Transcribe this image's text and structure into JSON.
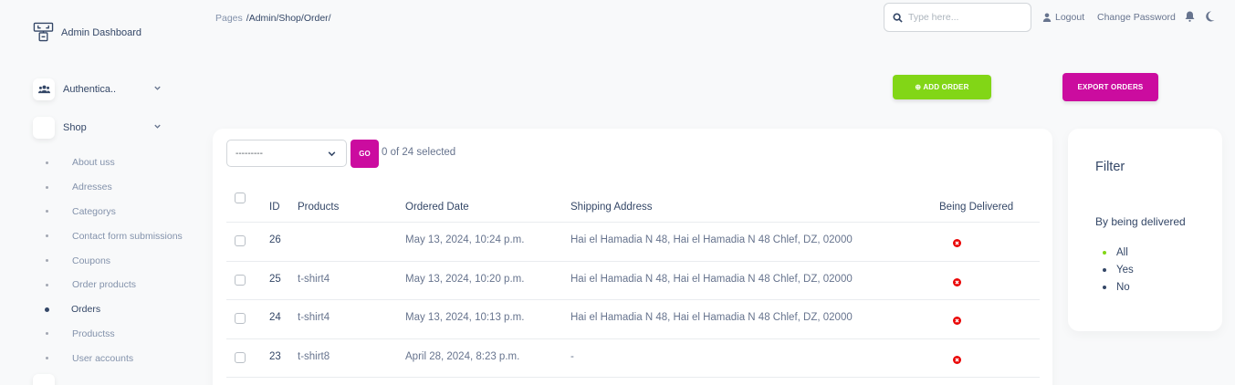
{
  "brand": {
    "name": "Admin Dashboard"
  },
  "sidebar": {
    "groups": [
      {
        "label": "Authentica..",
        "icon": "users-icon"
      },
      {
        "label": "Shop",
        "icon": "shop-icon"
      }
    ],
    "items": [
      {
        "label": "About uss"
      },
      {
        "label": "Adresses"
      },
      {
        "label": "Categorys"
      },
      {
        "label": "Contact form submissions"
      },
      {
        "label": "Coupons"
      },
      {
        "label": "Order products"
      },
      {
        "label": "Orders",
        "active": true
      },
      {
        "label": "Productss"
      },
      {
        "label": "User accounts"
      }
    ]
  },
  "header": {
    "breadcrumb_root": "Pages",
    "breadcrumb_path": "/Admin/Shop/Order/",
    "search_placeholder": "Type here...",
    "logout_label": "Logout",
    "change_password_label": "Change Password"
  },
  "actions": {
    "add_label": "ADD ORDER",
    "export_label": "EXPORT ORDERS"
  },
  "bulk": {
    "select_value": "---------",
    "go_label": "GO",
    "selected_text": "0 of 24 selected"
  },
  "table": {
    "columns": [
      "ID",
      "Products",
      "Ordered Date",
      "Shipping Address",
      "Being Delivered"
    ],
    "rows": [
      {
        "id": "26",
        "products": "",
        "date": "May 13, 2024, 10:24 p.m.",
        "address": "Hai el Hamadia N 48, Hai el Hamadia N 48 Chlef, DZ, 02000",
        "delivered": false
      },
      {
        "id": "25",
        "products": "t-shirt4",
        "date": "May 13, 2024, 10:20 p.m.",
        "address": "Hai el Hamadia N 48, Hai el Hamadia N 48 Chlef, DZ, 02000",
        "delivered": false
      },
      {
        "id": "24",
        "products": "t-shirt4",
        "date": "May 13, 2024, 10:13 p.m.",
        "address": "Hai el Hamadia N 48, Hai el Hamadia N 48 Chlef, DZ, 02000",
        "delivered": false
      },
      {
        "id": "23",
        "products": "t-shirt8",
        "date": "April 28, 2024, 8:23 p.m.",
        "address": "-",
        "delivered": false
      }
    ]
  },
  "filter": {
    "title": "Filter",
    "subtitle": "By being delivered",
    "options": [
      {
        "label": "All",
        "selected": true
      },
      {
        "label": "Yes"
      },
      {
        "label": "No"
      }
    ]
  },
  "colors": {
    "primary": "#cb0c9f",
    "success": "#82d616",
    "danger": "#ea0606",
    "text": "#344767",
    "muted": "#8392ab"
  }
}
